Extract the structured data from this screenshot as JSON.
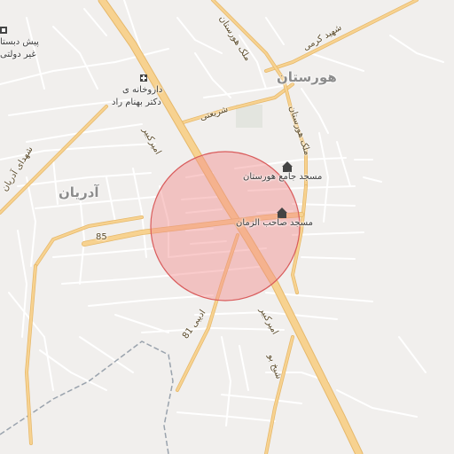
{
  "map": {
    "area_labels": {
      "hurestan": "هورستان",
      "adriyan": "آدریان"
    },
    "poi_labels": {
      "mosque_jame": "مسجد جامع هورستان",
      "mosque_saheb": "مسجد صاحب الزمان",
      "pharmacy_line1": "داروخانه ی",
      "pharmacy_line2": "دکتر بهنام راد",
      "school_line1": "پیش دبستا",
      "school_line2": "غیر دولتی"
    },
    "road_labels": {
      "amir_kabir_top": "امیرکبیر",
      "amir_kabir_bottom": "امیرکبیر",
      "shariati": "شریعتی",
      "malek_hurestan_top": "ملک هورستان",
      "malek_hurestan_side": "ملک هورستان",
      "shahid_kazemi": "شهید کرمی",
      "shahid_adriyan": "شهدای آدریان",
      "road_85": "85",
      "sheikh": "شیخ بو",
      "adib_81": "ادیبی 81"
    },
    "icons": [
      "mosque-icon",
      "mosque-icon",
      "pharmacy-icon",
      "school-icon"
    ],
    "colors": {
      "background": "#f1efed",
      "major_road": "#f7d290",
      "major_road_edge": "#e6b86a",
      "minor_road": "#ffffff",
      "highlight_circle_fill": "#f28b8b",
      "highlight_circle_stroke": "#d95c5c",
      "boundary": "#9aa3ad"
    }
  }
}
